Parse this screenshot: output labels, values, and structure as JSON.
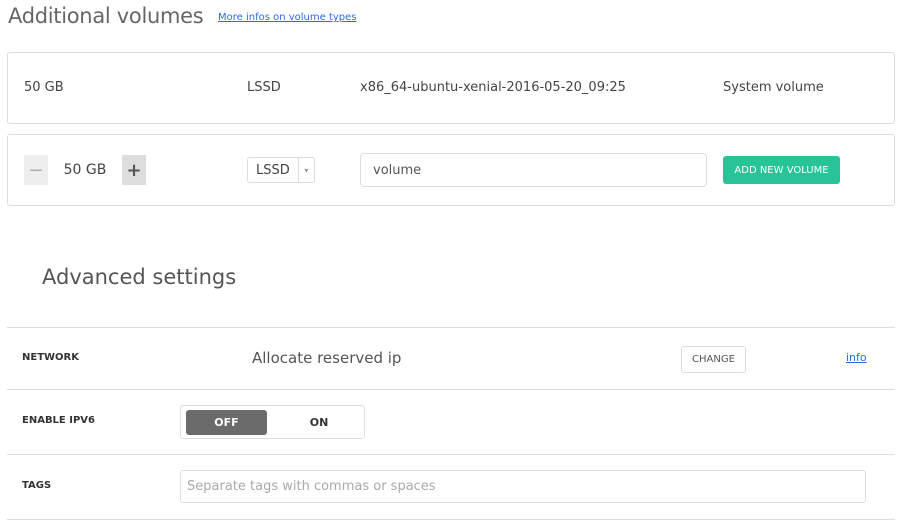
{
  "volumes": {
    "title": "Additional volumes",
    "info_link": "More infos on volume types",
    "system": {
      "size": "50 GB",
      "type": "LSSD",
      "image": "x86_64-ubuntu-xenial-2016-05-20_09:25",
      "role": "System volume"
    },
    "new": {
      "minus": "−",
      "size": "50 GB",
      "plus": "+",
      "type": "LSSD",
      "arrow": "▾",
      "name_value": "volume",
      "add_label": "ADD NEW VOLUME"
    }
  },
  "advanced": {
    "title": "Advanced settings",
    "network": {
      "label": "NETWORK",
      "value": "Allocate reserved ip",
      "change_label": "CHANGE",
      "info_link": "info"
    },
    "ipv6": {
      "label": "ENABLE IPV6",
      "off": "OFF",
      "on": "ON",
      "selected": "OFF"
    },
    "tags": {
      "label": "TAGS",
      "placeholder": "Separate tags with commas or spaces"
    }
  },
  "colors": {
    "accent": "#28c397",
    "link": "#2b6be6",
    "toggle_active": "#6b6b6b"
  }
}
